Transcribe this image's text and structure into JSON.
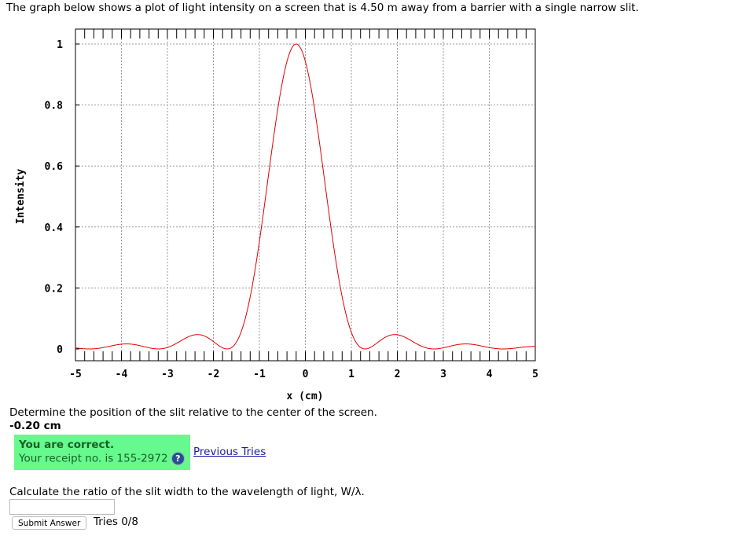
{
  "intro": "The graph below shows a plot of light intensity on a screen that is 4.50 m away from a barrier with a single narrow slit.",
  "chart_data": {
    "type": "line",
    "xlabel": "x (cm)",
    "ylabel": "Intensity",
    "xlim": [
      -5,
      5
    ],
    "ylim": [
      0,
      1
    ],
    "xticks": [
      "-5",
      "-4",
      "-3",
      "-2",
      "-1",
      "0",
      "1",
      "2",
      "3",
      "4",
      "5"
    ],
    "yticks": [
      "0",
      "0.2",
      "0.4",
      "0.6",
      "0.8",
      "1"
    ],
    "grid": true,
    "series": [
      {
        "shape": "single-slit sinc squared",
        "peak_x": -0.2,
        "peak_intensity": 1,
        "first_minimum_offset": 1.5,
        "color": "#e00000"
      }
    ]
  },
  "question1": "Determine the position of the slit relative to the center of the screen.",
  "answer1": "-0.20 cm",
  "feedback": {
    "title": "You are correct.",
    "receipt": "Your receipt no. is 155-2972",
    "help_icon": "?",
    "color": "#66f98e"
  },
  "previous_tries": "Previous Tries",
  "question2": "Calculate the ratio of the slit width to the wavelength of light, W/λ.",
  "answer2": "",
  "submit_label": "Submit Answer",
  "tries": "Tries 0/8"
}
